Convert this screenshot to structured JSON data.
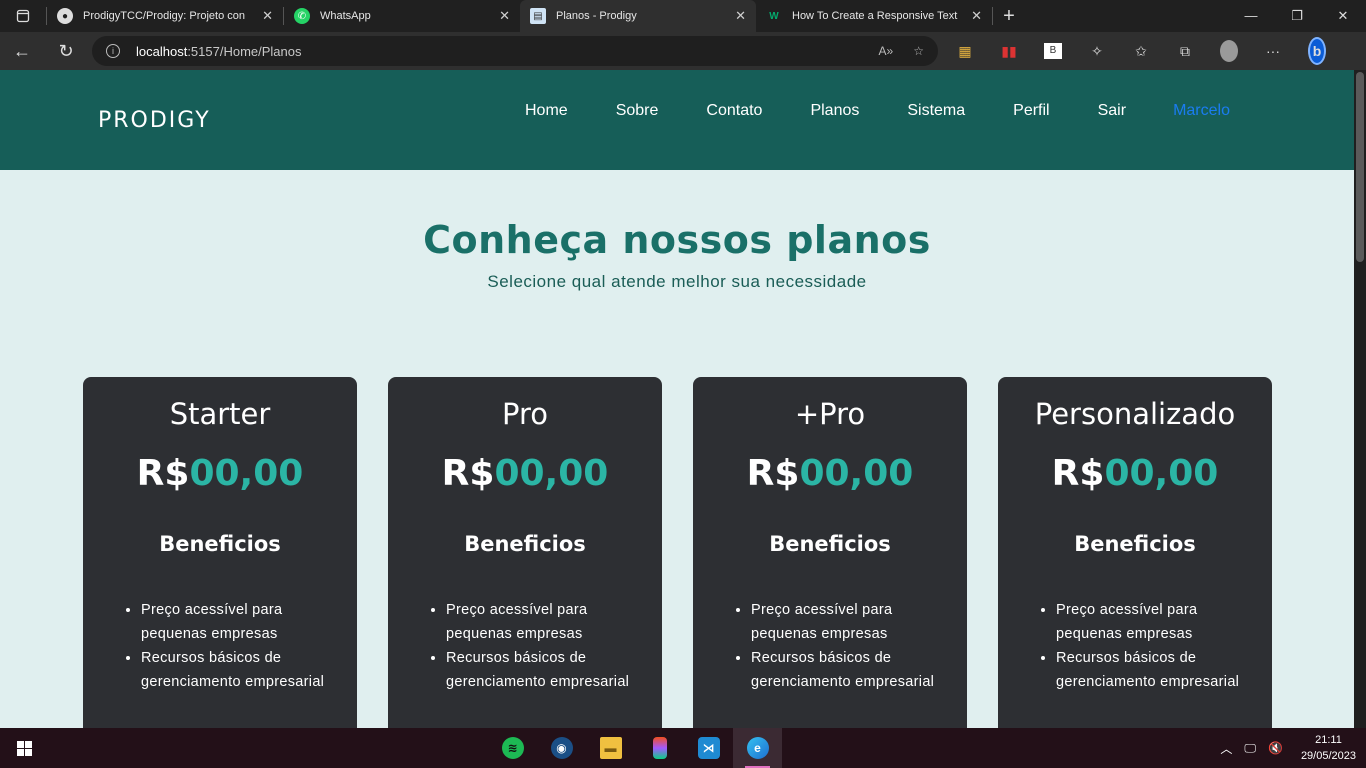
{
  "browser": {
    "tabs": [
      {
        "title": "ProdigyTCC/Prodigy: Projeto con",
        "icon": "github-icon",
        "active": false
      },
      {
        "title": "WhatsApp",
        "icon": "whatsapp-icon",
        "active": false
      },
      {
        "title": "Planos - Prodigy",
        "icon": "page-icon",
        "active": true
      },
      {
        "title": "How To Create a Responsive Text",
        "icon": "w3schools-icon",
        "active": false
      }
    ],
    "url_host": "localhost",
    "url_path": ":5157/Home/Planos"
  },
  "site": {
    "logo": "PRODIGY",
    "nav": [
      "Home",
      "Sobre",
      "Contato",
      "Planos",
      "Sistema",
      "Perfil",
      "Sair"
    ],
    "user": "Marcelo"
  },
  "hero": {
    "title": "Conheça nossos planos",
    "subtitle": "Selecione qual atende melhor sua necessidade"
  },
  "plans": [
    {
      "name": "Starter",
      "currency": "R$",
      "price": "00,00",
      "benefits_title": "Beneficios",
      "benefits": [
        "Preço acessível para pequenas empresas",
        "Recursos básicos de gerenciamento empresarial"
      ]
    },
    {
      "name": "Pro",
      "currency": "R$",
      "price": "00,00",
      "benefits_title": "Beneficios",
      "benefits": [
        "Preço acessível para pequenas empresas",
        "Recursos básicos de gerenciamento empresarial"
      ]
    },
    {
      "name": "+Pro",
      "currency": "R$",
      "price": "00,00",
      "benefits_title": "Beneficios",
      "benefits": [
        "Preço acessível para pequenas empresas",
        "Recursos básicos de gerenciamento empresarial"
      ]
    },
    {
      "name": "Personalizado",
      "currency": "R$",
      "price": "00,00",
      "benefits_title": "Beneficios",
      "benefits": [
        "Preço acessível para pequenas empresas",
        "Recursos básicos de gerenciamento empresarial"
      ]
    }
  ],
  "taskbar": {
    "apps": [
      "spotify-icon",
      "steam-icon",
      "file-explorer-icon",
      "figma-icon",
      "vscode-icon",
      "edge-icon"
    ],
    "time": "21:11",
    "date": "29/05/2023"
  },
  "colors": {
    "site_header": "#165e58",
    "page_bg": "#e0efef",
    "card_bg": "#2d2f33",
    "price_accent": "#2bb5a5",
    "user_link": "#1a7cf0"
  }
}
